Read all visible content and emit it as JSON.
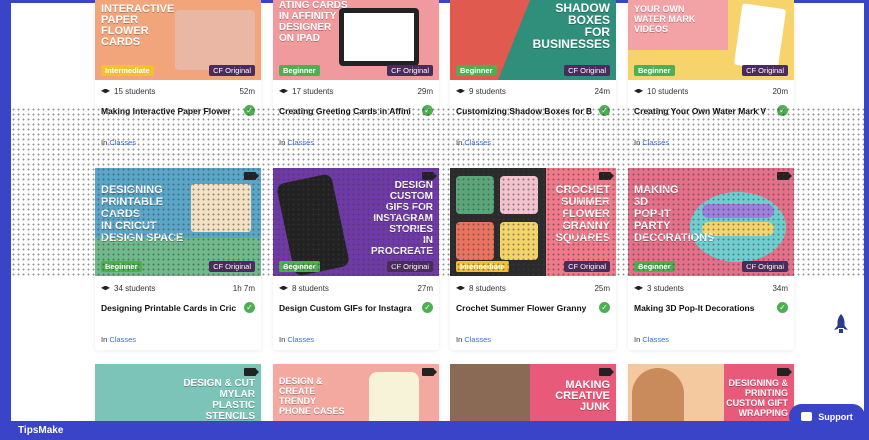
{
  "brand": "TipsMake",
  "support_label": "Support",
  "colors": {
    "accent": "#3a44c9",
    "check": "#4caf50",
    "link": "#3a6fd8"
  },
  "cards": [
    {
      "title": "Making Interactive Paper Flower",
      "thumb_text": "INTERACTIVE\nPAPER\nFLOWER\nCARDS",
      "thumb_bg": "#f2a57a",
      "level": "Intermediate",
      "tag": "CF Original",
      "students": "15 students",
      "duration": "52m",
      "in": "In ",
      "category": "Classes"
    },
    {
      "title": "Creating Greeting Cards in Affini",
      "thumb_text": "ATING CARDS\nIN AFFINITY\nDESIGNER\nON IPAD",
      "thumb_bg": "#f19a9e",
      "level": "Beginner",
      "tag": "CF Original",
      "students": "17 students",
      "duration": "29m",
      "in": "In ",
      "category": "Classes"
    },
    {
      "title": "Customizing Shadow Boxes for B",
      "thumb_text": "SHADOW\nBOXES\nFOR\nBUSINESSES",
      "thumb_bg": "#2f8f7a",
      "level": "Beginner",
      "tag": "CF Original",
      "students": "9 students",
      "duration": "24m",
      "in": "In ",
      "category": "Classes"
    },
    {
      "title": "Creating Your Own Water Mark V",
      "thumb_text": "YOUR OWN\nWATER MARK\nVIDEOS",
      "thumb_bg": "#f6d36b",
      "level": "Beginner",
      "tag": "CF Original",
      "students": "10 students",
      "duration": "20m",
      "in": "In ",
      "category": "Classes"
    },
    {
      "title": "Designing Printable Cards in Cric",
      "thumb_text": "DESIGNING\nPRINTABLE\nCARDS\nIN CRICUT\nDESIGN SPACE",
      "thumb_bg": "#5aa6c9",
      "level": "Beginner",
      "tag": "CF Original",
      "students": "34 students",
      "duration": "1h 7m",
      "in": "In ",
      "category": "Classes"
    },
    {
      "title": "Design Custom GIFs for Instagra",
      "thumb_text": "DESIGN\nCUSTOM\nGIFS FOR\nINSTAGRAM\nSTORIES\nIN\nPROCREATE",
      "thumb_bg": "#6f3aa8",
      "level": "Beginner",
      "tag": "CF Original",
      "students": "8 students",
      "duration": "27m",
      "in": "In ",
      "category": "Classes"
    },
    {
      "title": "Crochet Summer Flower Granny",
      "thumb_text": "CROCHET\nSUMMER\nFLOWER\nGRANNY\nSQUARES",
      "thumb_bg": "#f07a8a",
      "level": "Intermediate",
      "tag": "CF Original",
      "students": "8 students",
      "duration": "25m",
      "in": "In ",
      "category": "Classes"
    },
    {
      "title": "Making 3D Pop-It Decorations",
      "thumb_text": "MAKING\n3D\nPOP-IT\nPARTY\nDECORATIONS",
      "thumb_bg": "#e4708a",
      "level": "Beginner",
      "tag": "CF Original",
      "students": "3 students",
      "duration": "34m",
      "in": "In ",
      "category": "Classes"
    },
    {
      "title": "",
      "thumb_text": "DESIGN & CUT\nMYLAR\nPLASTIC\nSTENCILS",
      "thumb_bg": "#7cc4b8",
      "level": "",
      "tag": "",
      "students": "",
      "duration": "",
      "in": "",
      "category": ""
    },
    {
      "title": "",
      "thumb_text": "DESIGN &\nCREATE\nTRENDY\nPHONE CASES",
      "thumb_bg": "#f3a9a0",
      "level": "",
      "tag": "",
      "students": "",
      "duration": "",
      "in": "",
      "category": ""
    },
    {
      "title": "",
      "thumb_text": "MAKING\nCREATIVE\nJUNK",
      "thumb_bg": "#8a6a55",
      "level": "",
      "tag": "",
      "students": "",
      "duration": "",
      "in": "",
      "category": ""
    },
    {
      "title": "",
      "thumb_text": "DESIGNING &\nPRINTING\nCUSTOM GIFT\nWRAPPING",
      "thumb_bg": "#f5c9a0",
      "level": "",
      "tag": "",
      "students": "",
      "duration": "",
      "in": "",
      "category": ""
    }
  ]
}
